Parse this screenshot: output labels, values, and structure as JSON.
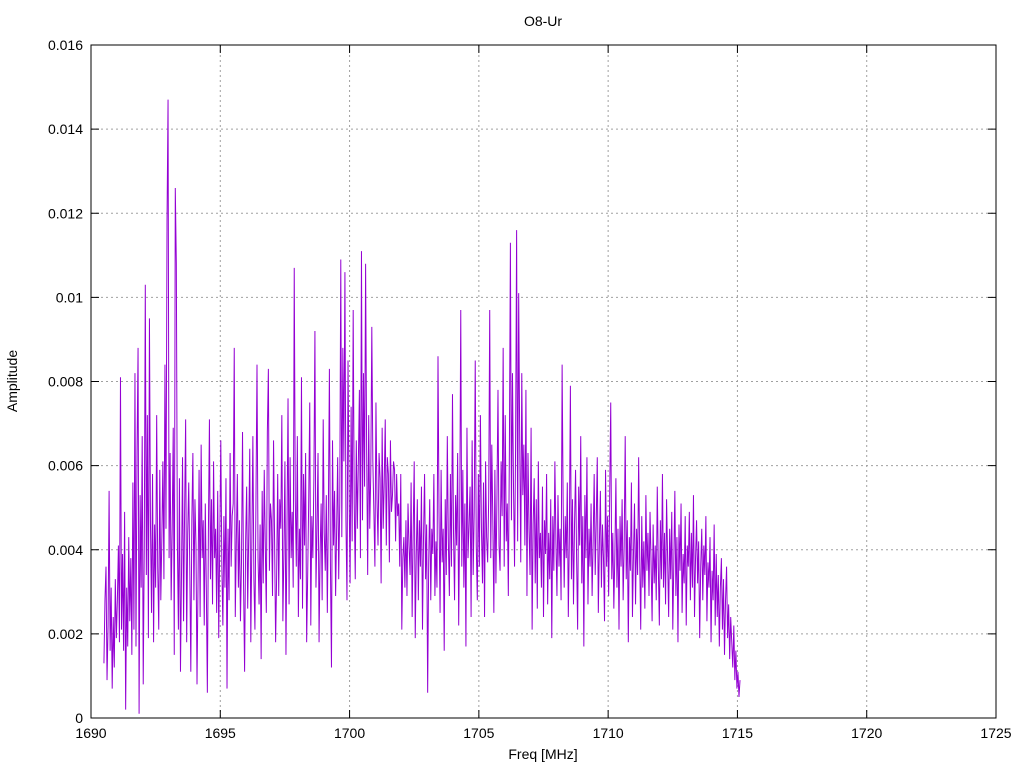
{
  "chart_data": {
    "type": "line",
    "title": "O8-Ur",
    "xlabel": "Freq [MHz]",
    "ylabel": "Amplitude",
    "xlim": [
      1690,
      1725
    ],
    "ylim": [
      0,
      0.016
    ],
    "xticks": [
      "1690",
      "1695",
      "1700",
      "1705",
      "1710",
      "1715",
      "1720",
      "1725"
    ],
    "yticks": [
      "0",
      "0.002",
      "0.004",
      "0.006",
      "0.008",
      "0.01",
      "0.012",
      "0.014",
      "0.016"
    ],
    "grid": true,
    "line_color": "#9400d3",
    "series": [
      {
        "x_start": 1690.5,
        "x_step": 0.04,
        "values": [
          0.0013,
          0.0028,
          0.0036,
          0.0009,
          0.0022,
          0.0054,
          0.0016,
          0.0031,
          0.0007,
          0.0024,
          0.0012,
          0.0033,
          0.0019,
          0.0028,
          0.0041,
          0.0018,
          0.0081,
          0.0021,
          0.0039,
          0.0016,
          0.0049,
          0.0002,
          0.0031,
          0.0017,
          0.0043,
          0.0023,
          0.0038,
          0.0015,
          0.0056,
          0.0021,
          0.0082,
          0.0017,
          0.0063,
          0.0088,
          0.0001,
          0.0053,
          0.0031,
          0.0067,
          0.0008,
          0.0041,
          0.0103,
          0.0034,
          0.0072,
          0.0019,
          0.0095,
          0.0046,
          0.0025,
          0.0058,
          0.0018,
          0.0046,
          0.0031,
          0.0072,
          0.0036,
          0.0021,
          0.0059,
          0.0028,
          0.0043,
          0.0061,
          0.0033,
          0.0084,
          0.0045,
          0.0118,
          0.0147,
          0.0038,
          0.0063,
          0.0028,
          0.0045,
          0.0069,
          0.0015,
          0.0126,
          0.0108,
          0.0042,
          0.0021,
          0.0057,
          0.0011,
          0.0034,
          0.0062,
          0.0023,
          0.0049,
          0.0071,
          0.0018,
          0.0044,
          0.0056,
          0.0036,
          0.0011,
          0.0047,
          0.0063,
          0.0028,
          0.0052,
          0.0041,
          0.0008,
          0.0033,
          0.0059,
          0.0024,
          0.0065,
          0.0038,
          0.0047,
          0.0022,
          0.0051,
          0.0031,
          0.0006,
          0.0044,
          0.0071,
          0.0033,
          0.0052,
          0.0027,
          0.0061,
          0.0038,
          0.0045,
          0.0025,
          0.0054,
          0.0019,
          0.0042,
          0.0066,
          0.0036,
          0.0022,
          0.0048,
          0.0031,
          0.0057,
          0.0007,
          0.0045,
          0.0028,
          0.0063,
          0.0036,
          0.0048,
          0.0051,
          0.0088,
          0.0024,
          0.0042,
          0.0058,
          0.0031,
          0.0047,
          0.0023,
          0.0037,
          0.0068,
          0.0032,
          0.0011,
          0.0042,
          0.0055,
          0.0026,
          0.0044,
          0.0064,
          0.0018,
          0.0041,
          0.0067,
          0.0033,
          0.0021,
          0.0052,
          0.0084,
          0.0038,
          0.0027,
          0.0046,
          0.0014,
          0.0054,
          0.0032,
          0.0059,
          0.0041,
          0.0025,
          0.0068,
          0.0083,
          0.0035,
          0.0051,
          0.0047,
          0.0029,
          0.0066,
          0.0042,
          0.0018,
          0.0034,
          0.0058,
          0.0029,
          0.0052,
          0.0045,
          0.0072,
          0.0023,
          0.0039,
          0.0061,
          0.0015,
          0.0046,
          0.0076,
          0.0027,
          0.0062,
          0.0038,
          0.0049,
          0.0031,
          0.0107,
          0.0052,
          0.0036,
          0.0067,
          0.0024,
          0.0045,
          0.0033,
          0.0081,
          0.0026,
          0.0058,
          0.0041,
          0.0063,
          0.0018,
          0.0034,
          0.0052,
          0.0075,
          0.0022,
          0.0048,
          0.0038,
          0.0057,
          0.0092,
          0.0031,
          0.0045,
          0.0063,
          0.0018,
          0.0039,
          0.0051,
          0.0028,
          0.0071,
          0.0044,
          0.0035,
          0.0053,
          0.0025,
          0.0049,
          0.0083,
          0.0036,
          0.0012,
          0.0066,
          0.0041,
          0.0054,
          0.0029,
          0.0045,
          0.0062,
          0.0033,
          0.0051,
          0.0109,
          0.0043,
          0.0088,
          0.0061,
          0.0106,
          0.0047,
          0.0028,
          0.0085,
          0.0055,
          0.0032,
          0.0074,
          0.0042,
          0.0097,
          0.0051,
          0.0033,
          0.0066,
          0.0045,
          0.0061,
          0.0078,
          0.0038,
          0.0111,
          0.0047,
          0.0082,
          0.0055,
          0.0108,
          0.0064,
          0.0034,
          0.0072,
          0.0045,
          0.0058,
          0.0093,
          0.0061,
          0.0049,
          0.0036,
          0.0075,
          0.0052,
          0.0041,
          0.0063,
          0.0057,
          0.0032,
          0.0069,
          0.0045,
          0.0056,
          0.0071,
          0.0041,
          0.0062,
          0.0058,
          0.0037,
          0.0066,
          0.0049,
          0.0053,
          0.0061,
          0.0059,
          0.0042,
          0.0058,
          0.0048,
          0.0051,
          0.0036,
          0.0058,
          0.0021,
          0.0038,
          0.0043,
          0.0031,
          0.0047,
          0.0029,
          0.0051,
          0.0041,
          0.0034,
          0.0056,
          0.0024,
          0.0044,
          0.0061,
          0.0019,
          0.0039,
          0.0052,
          0.0028,
          0.0047,
          0.0036,
          0.0055,
          0.0021,
          0.0043,
          0.0058,
          0.0033,
          0.0046,
          0.0006,
          0.0037,
          0.0052,
          0.0028,
          0.0045,
          0.0039,
          0.0058,
          0.0029,
          0.0042,
          0.0031,
          0.0086,
          0.0048,
          0.0025,
          0.0059,
          0.0037,
          0.0045,
          0.0016,
          0.0052,
          0.0034,
          0.0067,
          0.0042,
          0.0029,
          0.0058,
          0.0036,
          0.0077,
          0.0044,
          0.0028,
          0.0053,
          0.0041,
          0.0063,
          0.0022,
          0.0048,
          0.0097,
          0.0036,
          0.0059,
          0.0031,
          0.0051,
          0.0017,
          0.0069,
          0.0038,
          0.0046,
          0.0055,
          0.0024,
          0.0066,
          0.0034,
          0.0049,
          0.0085,
          0.0041,
          0.0028,
          0.0058,
          0.0036,
          0.0072,
          0.0045,
          0.0032,
          0.0056,
          0.0024,
          0.0061,
          0.0043,
          0.0037,
          0.0052,
          0.0097,
          0.0038,
          0.0065,
          0.0047,
          0.0025,
          0.0059,
          0.0032,
          0.0053,
          0.0078,
          0.0041,
          0.0035,
          0.0061,
          0.0048,
          0.0088,
          0.0036,
          0.0072,
          0.0042,
          0.0051,
          0.0029,
          0.0063,
          0.0113,
          0.0047,
          0.0082,
          0.0055,
          0.0036,
          0.0064,
          0.0116,
          0.0042,
          0.0101,
          0.0066,
          0.0037,
          0.0082,
          0.0053,
          0.0065,
          0.0041,
          0.0078,
          0.0029,
          0.0063,
          0.0045,
          0.0034,
          0.0069,
          0.0021,
          0.0046,
          0.0057,
          0.0032,
          0.0052,
          0.0026,
          0.0061,
          0.0038,
          0.0044,
          0.0031,
          0.0055,
          0.0024,
          0.0047,
          0.0039,
          0.0058,
          0.0027,
          0.0044,
          0.0033,
          0.0052,
          0.0019,
          0.0048,
          0.0035,
          0.0061,
          0.0042,
          0.0029,
          0.0053,
          0.0036,
          0.0045,
          0.0028,
          0.0084,
          0.0051,
          0.0031,
          0.0048,
          0.0038,
          0.0056,
          0.0024,
          0.0043,
          0.0079,
          0.0033,
          0.0052,
          0.0027,
          0.0046,
          0.0059,
          0.0038,
          0.0021,
          0.0055,
          0.0041,
          0.0067,
          0.0032,
          0.0048,
          0.0017,
          0.0053,
          0.0038,
          0.0062,
          0.0027,
          0.0045,
          0.0036,
          0.0051,
          0.0029,
          0.0042,
          0.0058,
          0.0034,
          0.0047,
          0.0062,
          0.0025,
          0.0041,
          0.0054,
          0.0031,
          0.0046,
          0.0038,
          0.0023,
          0.0059,
          0.0036,
          0.0048,
          0.0029,
          0.0053,
          0.0075,
          0.0033,
          0.0044,
          0.0026,
          0.0039,
          0.0057,
          0.0031,
          0.0045,
          0.0021,
          0.0048,
          0.0036,
          0.0052,
          0.0028,
          0.0041,
          0.0067,
          0.0033,
          0.0047,
          0.0018,
          0.0043,
          0.0035,
          0.0056,
          0.0024,
          0.0039,
          0.0051,
          0.0027,
          0.0045,
          0.0034,
          0.0062,
          0.0038,
          0.0021,
          0.0048,
          0.0031,
          0.0042,
          0.0026,
          0.0053,
          0.0035,
          0.0044,
          0.0029,
          0.0049,
          0.0037,
          0.0023,
          0.0046,
          0.0032,
          0.0041,
          0.0028,
          0.0055,
          0.0036,
          0.0022,
          0.0047,
          0.0033,
          0.0058,
          0.0031,
          0.0044,
          0.0027,
          0.0052,
          0.0038,
          0.0024,
          0.0045,
          0.0033,
          0.0049,
          0.0021,
          0.0037,
          0.0054,
          0.0029,
          0.0043,
          0.0018,
          0.0046,
          0.0035,
          0.0051,
          0.0025,
          0.0039,
          0.0032,
          0.0048,
          0.0022,
          0.0041,
          0.0036,
          0.0049,
          0.0028,
          0.0044,
          0.0031,
          0.0053,
          0.0024,
          0.0038,
          0.0047,
          0.0032,
          0.0042,
          0.0019,
          0.0036,
          0.0045,
          0.0028,
          0.0041,
          0.0034,
          0.0048,
          0.0023,
          0.0037,
          0.0031,
          0.0043,
          0.0018,
          0.0035,
          0.0028,
          0.0046,
          0.0022,
          0.0039,
          0.0024,
          0.0034,
          0.0017,
          0.0031,
          0.0038,
          0.0021,
          0.0033,
          0.0015,
          0.0028,
          0.0036,
          0.0019,
          0.0027,
          0.0014,
          0.0024,
          0.0018,
          0.0012,
          0.0022,
          0.0009,
          0.0016,
          0.0007,
          0.0011,
          0.0005,
          0.0009
        ]
      }
    ]
  }
}
